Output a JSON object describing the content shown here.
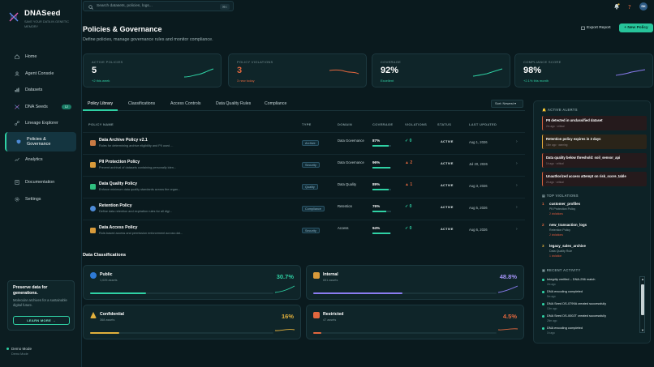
{
  "brand": {
    "name": "DNASeed",
    "tagline": "SAVE YOUR DATA IN GENETIC MEMORY"
  },
  "search": {
    "placeholder": "Search datasets, policies, logs...",
    "shortcut": "⌘K"
  },
  "topbar": {
    "avatar": "SK"
  },
  "sidebar": {
    "items": [
      {
        "label": "Home",
        "icon": "home-icon"
      },
      {
        "label": "Agent Console",
        "icon": "agent-icon"
      },
      {
        "label": "Datasets",
        "icon": "datasets-icon"
      },
      {
        "label": "DNA Seeds",
        "icon": "dna-icon",
        "badge": "12"
      },
      {
        "label": "Lineage Explorer",
        "icon": "lineage-icon"
      },
      {
        "label": "Policies & Governance",
        "icon": "shield-icon",
        "active": true
      },
      {
        "label": "Analytics",
        "icon": "analytics-icon"
      }
    ],
    "bottom_items": [
      {
        "label": "Documentation",
        "icon": "docs-icon"
      },
      {
        "label": "Settings",
        "icon": "gear-icon"
      }
    ],
    "promo": {
      "title": "Preserve data for generations.",
      "desc": "Molecular archives for a sustainable digital future.",
      "button": "LEARN MORE →"
    },
    "demo": {
      "label": "Demo Mode",
      "sub": "Demo Mode"
    }
  },
  "header": {
    "title": "Policies & Governance",
    "subtitle": "Define policies, manage governance rules and monitor compliance.",
    "export_label": "Export Report",
    "new_label": "+ New Policy"
  },
  "stats": [
    {
      "label": "ACTIVE POLICIES",
      "value": "5",
      "note": "+2 this week",
      "color": "#2fd1a4"
    },
    {
      "label": "POLICY VIOLATIONS",
      "value": "3",
      "note": "3 new today",
      "color": "#e2673e"
    },
    {
      "label": "COVERAGE",
      "value": "92%",
      "note": "Excellent",
      "color": "#2fd1a4"
    },
    {
      "label": "COMPLIANCE SCORE",
      "value": "98%",
      "note": "+2.1% this month",
      "color": "#2fd1a4"
    }
  ],
  "tabs": [
    "Policy Library",
    "Classifications",
    "Access Controls",
    "Data Quality Rules",
    "Compliance"
  ],
  "sort_label": "Sort: Newest ▾",
  "table": {
    "headers": [
      "POLICY NAME",
      "TYPE",
      "DOMAIN",
      "COVERAGE",
      "VIOLATIONS",
      "STATUS",
      "LAST UPDATED"
    ],
    "rows": [
      {
        "name": "Data Archive Policy v2.1",
        "desc": "Rules for determining archive eligibility and PII used ...",
        "type": "Archive",
        "domain": "Data Governance",
        "coverage": "87%",
        "cov_val": 87,
        "violations": "✓ 0",
        "vcolor": "#2fd1a4",
        "status": "ACTIVE",
        "updated": "Aug 1, 2026",
        "icolor": "#c97b44"
      },
      {
        "name": "PII Protection Policy",
        "desc": "Prevent archival of datasets containing personally iden...",
        "type": "Security",
        "domain": "Data Governance",
        "coverage": "96%",
        "cov_val": 96,
        "violations": "▲ 2",
        "vcolor": "#e2673e",
        "status": "ACTIVE",
        "updated": "Jul 20, 2026",
        "icolor": "#d89a3a"
      },
      {
        "name": "Data Quality Policy",
        "desc": "Enforce minimum data quality standards across the organ...",
        "type": "Quality",
        "domain": "Data Quality",
        "coverage": "89%",
        "cov_val": 89,
        "violations": "▲ 1",
        "vcolor": "#e2673e",
        "status": "ACTIVE",
        "updated": "Aug 3, 2026",
        "icolor": "#2fbf7f"
      },
      {
        "name": "Retention Policy",
        "desc": "Define data retention and expiration rules for all digi...",
        "type": "Compliance",
        "domain": "Retention",
        "coverage": "76%",
        "cov_val": 76,
        "violations": "✓ 0",
        "vcolor": "#2fd1a4",
        "status": "ACTIVE",
        "updated": "Aug 5, 2026",
        "icolor": "#4d8ad6"
      },
      {
        "name": "Data Access Policy",
        "desc": "Role-based access and permission enforcement across dat...",
        "type": "Security",
        "domain": "Access",
        "coverage": "94%",
        "cov_val": 94,
        "violations": "✓ 0",
        "vcolor": "#2fd1a4",
        "status": "ACTIVE",
        "updated": "Aug 6, 2026",
        "icolor": "#d89a3a"
      }
    ]
  },
  "classifications": {
    "title": "Data Classifications",
    "items": [
      {
        "name": "Public",
        "count": "1,025 assets",
        "pct": "30.7%",
        "val": 30.7,
        "color": "#2fd1a4"
      },
      {
        "name": "Internal",
        "count": "651 assets",
        "pct": "48.8%",
        "val": 48.8,
        "color": "#8a7cf0"
      },
      {
        "name": "Confidential",
        "count": "368 assets",
        "pct": "16%",
        "val": 16,
        "color": "#e2b03c"
      },
      {
        "name": "Restricted",
        "count": "47 assets",
        "pct": "4.5%",
        "val": 4.5,
        "color": "#e2673e"
      }
    ]
  },
  "alerts": {
    "title": "ACTIVE ALERTS",
    "items": [
      {
        "text": "PII detected in unclassified dataset",
        "time": "2m ago · critical",
        "level": "critical"
      },
      {
        "text": "Retention policy expires in 3 days",
        "time": "15m ago · warning",
        "level": "warn"
      },
      {
        "text": "Data quality below threshold: soil_sensor_api",
        "time": "1h ago · critical",
        "level": "critical"
      },
      {
        "text": "Unauthorized access attempt on risk_score_table",
        "time": "2h ago · critical",
        "level": "critical"
      }
    ]
  },
  "top_violations": {
    "title": "TOP VIOLATIONS",
    "items": [
      {
        "rank": "1",
        "name": "customer_profiles",
        "policy": "PII Protection Policy",
        "count": "2 violations",
        "color": "#e2673e"
      },
      {
        "rank": "2",
        "name": "new_transaction_logs",
        "policy": "Retention Policy",
        "count": "2 violations",
        "color": "#e2673e"
      },
      {
        "rank": "3",
        "name": "legacy_sales_archive",
        "policy": "Data Quality Rule",
        "count": "1 violation",
        "color": "#e2b03c"
      }
    ]
  },
  "activity": {
    "title": "RECENT ACTIVITY",
    "items": [
      {
        "text": "Integrity verified – DNA-256 match",
        "time": "2m ago"
      },
      {
        "text": "DNA encoding completed",
        "time": "5m ago"
      },
      {
        "text": "DNA Seed DS-0799A created successfully",
        "time": "12m ago"
      },
      {
        "text": "DNA Seed DS-0002T created successfully",
        "time": "25m ago"
      },
      {
        "text": "DNA encoding completed",
        "time": "1h ago"
      }
    ]
  }
}
